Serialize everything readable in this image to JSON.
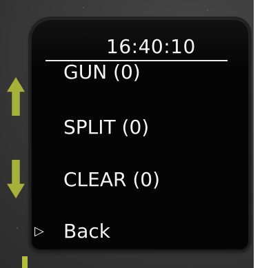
{
  "screen": {
    "time": "16:40:10",
    "menu_items": [
      {
        "label": "GUN (0)"
      },
      {
        "label": "SPLIT (0)"
      },
      {
        "label": "CLEAR (0)"
      }
    ],
    "back": {
      "icon": "triangle-right-outline-icon",
      "label": "Back"
    }
  },
  "hardware": {
    "up_button_icon": "arrow-up-icon",
    "down_button_icon": "arrow-down-icon",
    "accent_color": "#b3bf3a",
    "display_background": "#050505",
    "display_text_color": "#f4f4f4"
  }
}
